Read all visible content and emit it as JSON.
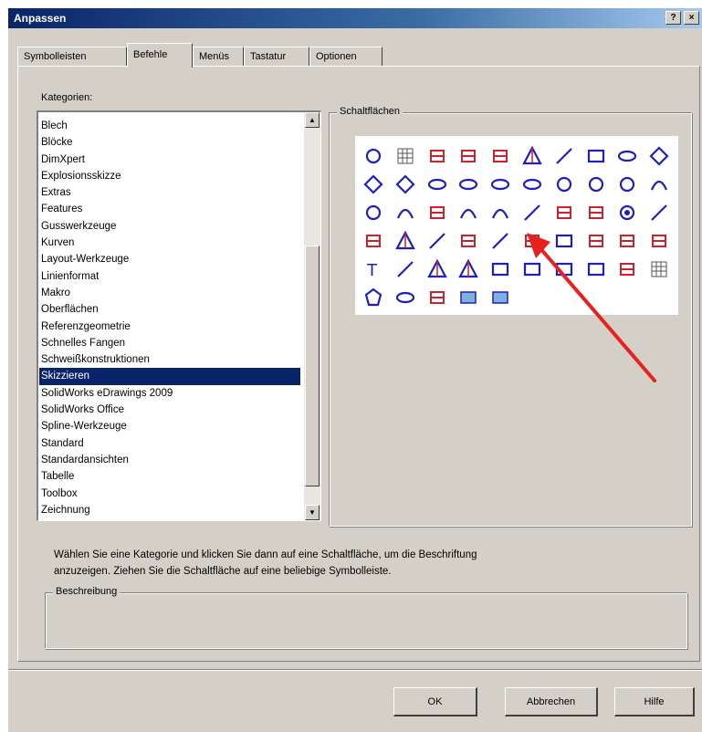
{
  "window": {
    "title": "Anpassen",
    "help_button": "?",
    "close_button": "×"
  },
  "tabs": [
    {
      "label": "Symbolleisten"
    },
    {
      "label": "Befehle",
      "active": true
    },
    {
      "label": "Menüs"
    },
    {
      "label": "Tastatur"
    },
    {
      "label": "Optionen"
    }
  ],
  "categories": {
    "label": "Kategorien:",
    "selected": "Skizzieren",
    "items": [
      "Blech",
      "Blöcke",
      "DimXpert",
      "Explosionsskizze",
      "Extras",
      "Features",
      "Gusswerkzeuge",
      "Kurven",
      "Layout-Werkzeuge",
      "Linienformat",
      "Makro",
      "Oberflächen",
      "Referenzgeometrie",
      "Schnelles Fangen",
      "Schweißkonstruktionen",
      "Skizzieren",
      "SolidWorks eDrawings 2009",
      "SolidWorks Office",
      "Spline-Werkzeuge",
      "Standard",
      "Standardansichten",
      "Tabelle",
      "Toolbox",
      "Zeichnung"
    ]
  },
  "buttons_panel": {
    "label": "Schaltflächen",
    "icons": [
      [
        "pointer-icon",
        "grid-icon",
        "smart-dimension-icon",
        "sketch-icon",
        "3d-sketch-icon",
        "ruled-surface-icon",
        "line-icon",
        "rectangle-icon",
        "rounded-slot-icon",
        "diamond-icon"
      ],
      [
        "parallelogram-icon",
        "parallelogram-outline-icon",
        "straight-slot-icon",
        "arc-slot-icon",
        "ellipse-icon",
        "partial-ellipse-icon",
        "circle-icon",
        "perimeter-circle-icon",
        "centerpoint-arc-icon",
        "tangent-arc-icon"
      ],
      [
        "three-point-arc-icon",
        "sketch-fillet-icon",
        "sketch-chamfer-icon",
        "parabola-icon",
        "u-shape-icon",
        "spline-icon",
        "offset-entities-icon",
        "construction-geometry-icon",
        "point-icon",
        "centerline-icon"
      ],
      [
        "convert-entities-icon",
        "mirror-icon",
        "linear-pattern-icon",
        "trim-icon",
        "extend-icon",
        "split-entities-icon",
        "copy-icon",
        "move-entities-icon",
        "rotate-icon",
        "scale-icon"
      ],
      [
        "text-icon",
        "pen-icon",
        "intersection-curve-icon",
        "face-curves-icon",
        "block-icon",
        "insert-block-icon",
        "make-block-icon",
        "explode-block-icon",
        "add-relation-icon",
        "array-icon"
      ],
      [
        "polygon-icon",
        "ellipse-outline-icon",
        "modify-sketch-icon",
        "sketch-picture-icon",
        "image-icon"
      ]
    ]
  },
  "description_text": [
    "Wählen Sie eine Kategorie und klicken Sie dann auf eine Schaltfläche, um die Beschriftung",
    "anzuzeigen. Ziehen Sie die Schaltfläche auf eine beliebige Symbolleiste."
  ],
  "description_group": {
    "label": "Beschreibung",
    "value": ""
  },
  "footer": {
    "ok": "OK",
    "cancel": "Abbrechen",
    "help": "Hilfe"
  },
  "annotation": {
    "arrow_color": "#e8201f"
  },
  "colors": {
    "dialog_bg": "#d4d0c8",
    "selection": "#0a246a",
    "title_start": "#0a246a",
    "icon_blue": "#1f1fbf",
    "icon_red": "#d0202a"
  }
}
